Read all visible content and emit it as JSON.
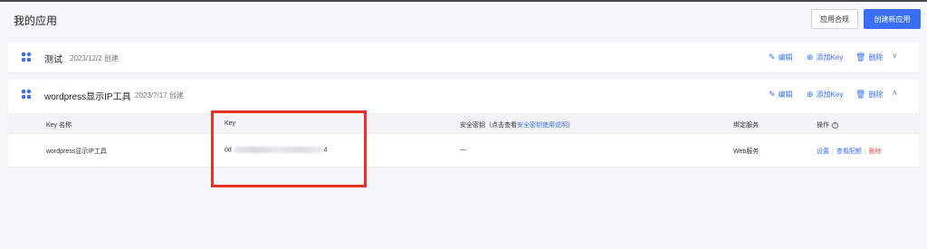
{
  "page": {
    "title": "我的应用",
    "buttons": {
      "compliance": "应用合规",
      "create": "创建新应用"
    }
  },
  "apps": [
    {
      "name": "测试",
      "created": "2023/12/2 创建"
    },
    {
      "name": "wordpress显示IP工具",
      "created": "2023/7/17 创建"
    }
  ],
  "actions": {
    "edit": "编辑",
    "add_key": "添加Key",
    "delete": "删除"
  },
  "table": {
    "headers": {
      "key_name": "Key 名称",
      "key": "Key",
      "secret_prefix": "安全密钥（点击查看",
      "secret_link": "安全密钥使用说明",
      "secret_suffix": "）",
      "service": "绑定服务",
      "ops": "操作"
    },
    "rows": [
      {
        "key_name": "wordpress显示IP工具",
        "key_start": "0d",
        "key_end": "4",
        "secret": "—",
        "service": "Web服务",
        "op_settings": "设置",
        "op_config": "查看配额",
        "op_delete": "删除"
      }
    ]
  },
  "colors": {
    "accent": "#3a6ff4",
    "danger": "#e2544e",
    "highlight": "#e8312a"
  },
  "icons": [
    "apps-grid-icon",
    "edit-icon",
    "add-circle-icon",
    "trash-icon",
    "chevron-down-icon",
    "chevron-up-icon",
    "info-icon"
  ]
}
